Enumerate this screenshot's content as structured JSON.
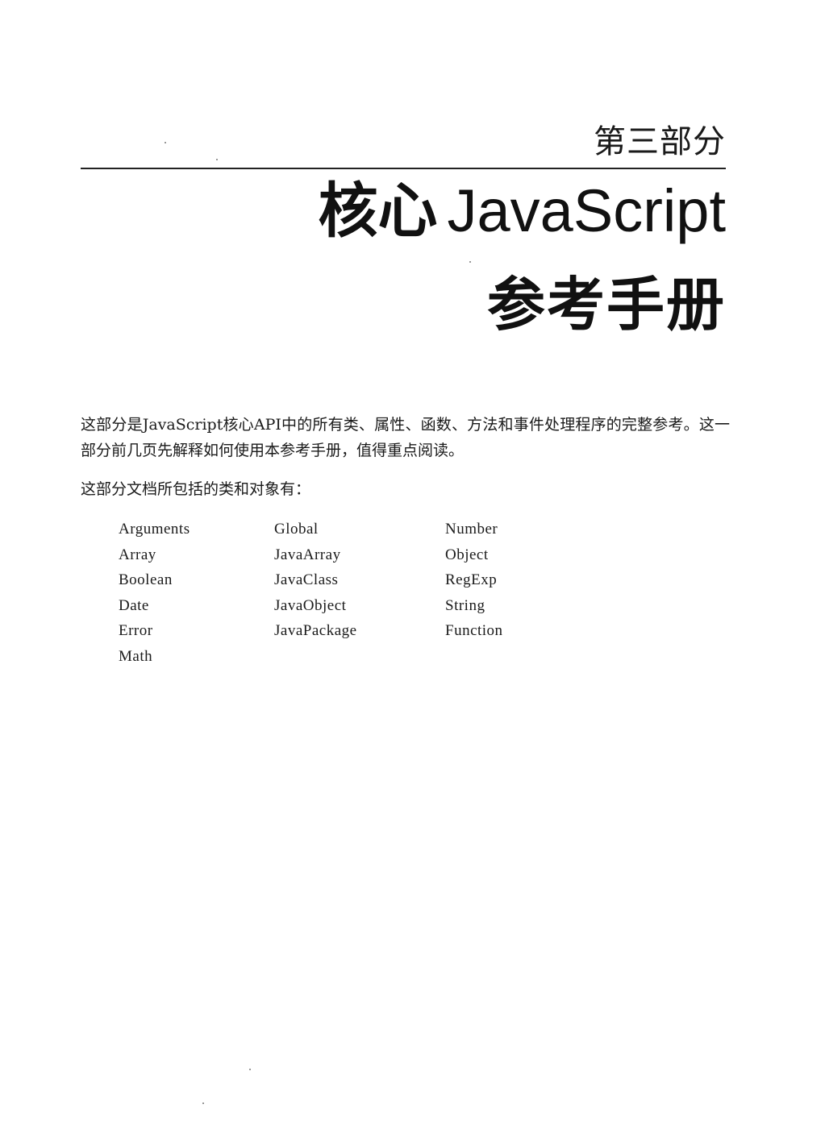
{
  "header": {
    "part_label": "第三部分",
    "title_cn": "核心",
    "title_en": "JavaScript",
    "subtitle": "参考手册"
  },
  "intro": {
    "paragraph": "这部分是JavaScript核心API中的所有类、属性、函数、方法和事件处理程序的完整参考。这一部分前几页先解释如何使用本参考手册，值得重点阅读。",
    "list_heading": "这部分文档所包括的类和对象有："
  },
  "classes": {
    "columns": [
      [
        "Arguments",
        "Array",
        "Boolean",
        "Date",
        "Error",
        "Math"
      ],
      [
        "Global",
        "JavaArray",
        "JavaClass",
        "JavaObject",
        "JavaPackage"
      ],
      [
        "Number",
        "Object",
        "RegExp",
        "String",
        "Function"
      ]
    ]
  }
}
